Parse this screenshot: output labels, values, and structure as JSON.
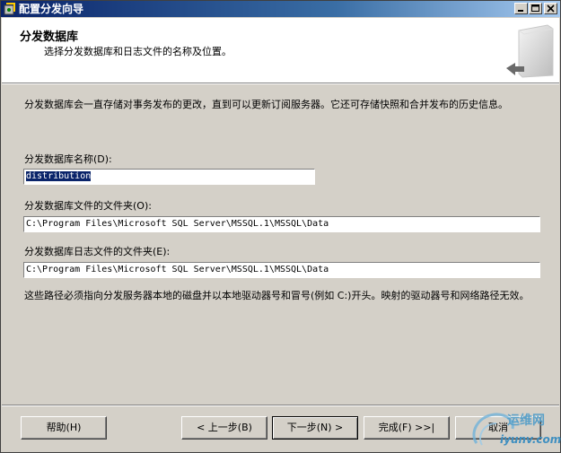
{
  "window": {
    "title": "配置分发向导"
  },
  "header": {
    "title": "分发数据库",
    "subtitle": "选择分发数据库和日志文件的名称及位置。"
  },
  "content": {
    "description": "分发数据库会一直存储对事务发布的更改，直到可以更新订阅服务器。它还可存储快照和合并发布的历史信息。",
    "db_name_label": "分发数据库名称(D):",
    "db_name_value": "distribution",
    "data_folder_label": "分发数据库文件的文件夹(O):",
    "data_folder_value": "C:\\Program Files\\Microsoft SQL Server\\MSSQL.1\\MSSQL\\Data",
    "log_folder_label": "分发数据库日志文件的文件夹(E):",
    "log_folder_value": "C:\\Program Files\\Microsoft SQL Server\\MSSQL.1\\MSSQL\\Data",
    "note": "这些路径必须指向分发服务器本地的磁盘并以本地驱动器号和冒号(例如 C:)开头。映射的驱动器号和网络路径无效。"
  },
  "buttons": {
    "help": "帮助(H)",
    "back": "< 上一步(B)",
    "next": "下一步(N) >",
    "finish": "完成(F) >>|",
    "cancel": "取消"
  },
  "watermark": {
    "top": "运维网",
    "bottom": "iyunv.com"
  }
}
